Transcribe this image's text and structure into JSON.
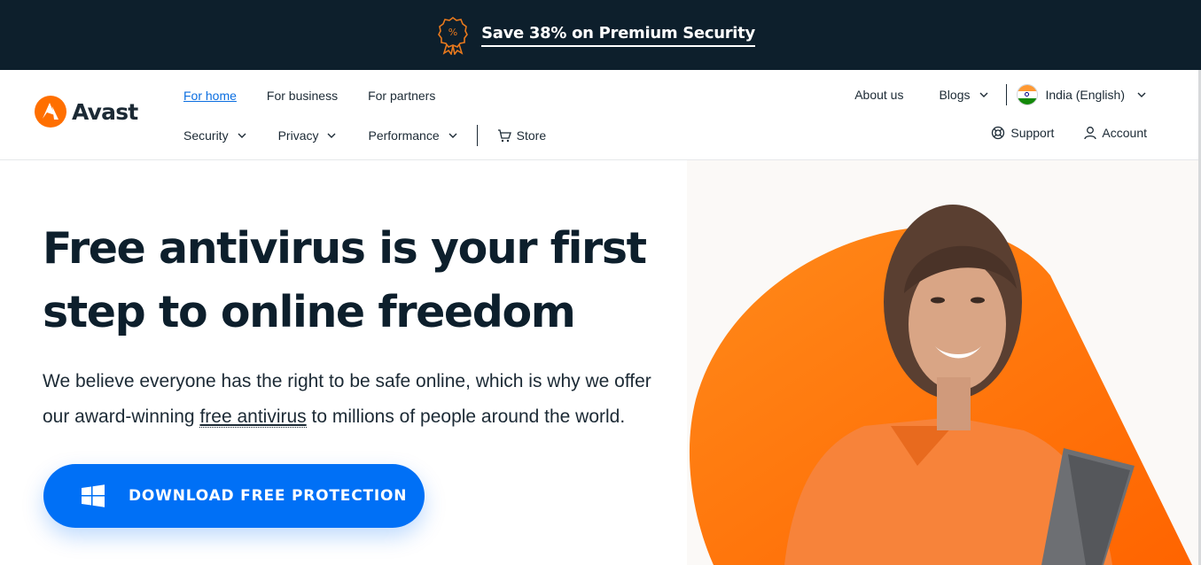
{
  "promo": {
    "label": "Save 38% on Premium Security",
    "icon": "discount-badge-icon"
  },
  "brand": {
    "name": "Avast",
    "accent": "#ff6f00"
  },
  "nav_top": {
    "home": "For home",
    "business": "For business",
    "partners": "For partners"
  },
  "nav_bottom": {
    "security": "Security",
    "privacy": "Privacy",
    "performance": "Performance",
    "store": "Store"
  },
  "utility": {
    "about": "About us",
    "blogs": "Blogs",
    "locale": "India (English)",
    "support": "Support",
    "account": "Account"
  },
  "hero": {
    "title": "Free antivirus is your first step to online freedom",
    "desc_before": "We believe everyone has the right to be safe online, which is why we offer our award-winning ",
    "desc_link": "free antivirus",
    "desc_after": " to millions of people around the world.",
    "cta_label": "DOWNLOAD FREE PROTECTION",
    "cta_icon": "windows-icon"
  },
  "colors": {
    "promo_bg": "#0d1f2c",
    "cta_blue": "#0070f6",
    "link_blue": "#0b6ee0"
  }
}
